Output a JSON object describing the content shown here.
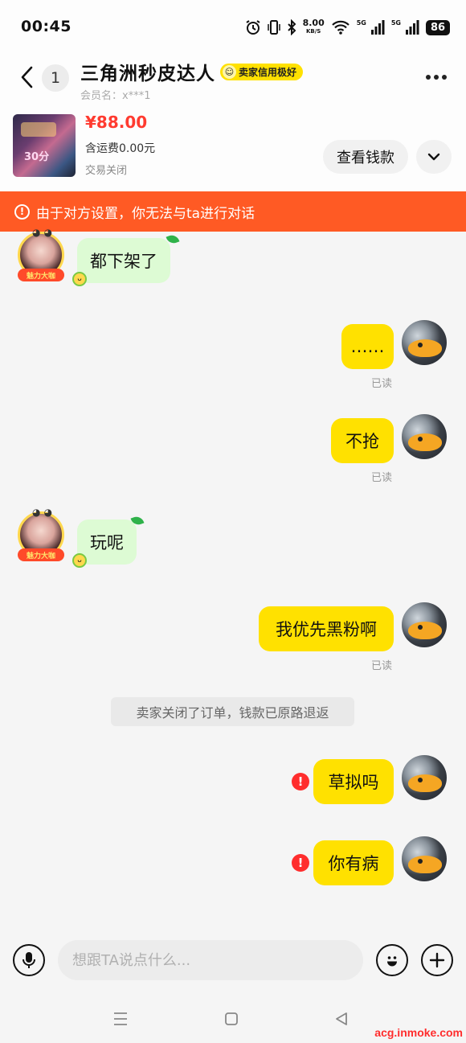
{
  "status_bar": {
    "time": "00:45",
    "speed_value": "8.00",
    "speed_unit": "KB/S",
    "net1": "5G",
    "net2": "5G",
    "battery": "86"
  },
  "header": {
    "unread_count": "1",
    "title": "三角洲秒皮达人",
    "credit_badge": "卖家信用极好",
    "member_name": "会员名：x***1"
  },
  "product": {
    "price": "¥88.00",
    "shipping": "含运费0.00元",
    "status": "交易关闭",
    "view_money_label": "查看钱款",
    "thumb_text": "30分"
  },
  "warning": {
    "text": "由于对方设置，你无法与ta进行对话"
  },
  "messages": [
    {
      "side": "left",
      "text": "都下架了"
    },
    {
      "side": "right",
      "text": "……",
      "read": "已读"
    },
    {
      "side": "right",
      "text": "不抢",
      "read": "已读"
    },
    {
      "side": "left",
      "text": "玩呢"
    },
    {
      "side": "right",
      "text": "我优先黑粉啊",
      "read": "已读"
    },
    {
      "side": "system",
      "text": "卖家关闭了订单，钱款已原路退返"
    },
    {
      "side": "right",
      "text": "草拟吗",
      "failed": true
    },
    {
      "side": "right",
      "text": "你有病",
      "failed": true
    }
  ],
  "seller_avatar_ribbon": "魅力大咖",
  "input": {
    "placeholder": "想跟TA说点什么..."
  },
  "watermark": "acg.inmoke.com",
  "colors": {
    "accent_yellow": "#ffe100",
    "warning_orange": "#ff5a24",
    "price_red": "#ff3b30",
    "seller_bubble": "#ddfbd4"
  }
}
